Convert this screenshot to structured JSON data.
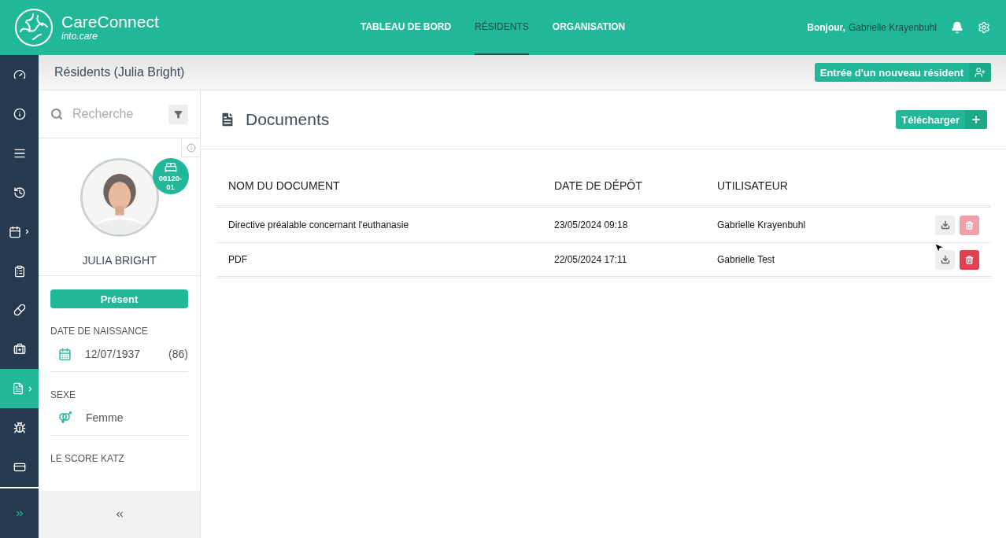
{
  "header": {
    "brand": "CareConnect",
    "brand_sub": "into.care",
    "nav": [
      {
        "label": "TABLEAU DE BORD",
        "selected": false
      },
      {
        "label": "RÉSIDENTS",
        "selected": true
      },
      {
        "label": "ORGANISATION",
        "selected": false
      }
    ],
    "greeting": "Bonjour,",
    "user": "Gabrielle Krayenbuhl"
  },
  "sidebar": {
    "items": [
      {
        "selected": false,
        "has_submenu": false
      },
      {
        "selected": false,
        "has_submenu": false
      },
      {
        "selected": false,
        "has_submenu": false
      },
      {
        "selected": false,
        "has_submenu": false
      },
      {
        "selected": false,
        "has_submenu": true
      },
      {
        "selected": false,
        "has_submenu": false
      },
      {
        "selected": false,
        "has_submenu": false
      },
      {
        "selected": false,
        "has_submenu": false
      },
      {
        "selected": true,
        "has_submenu": true
      },
      {
        "selected": false,
        "has_submenu": false
      },
      {
        "selected": false,
        "has_submenu": false
      }
    ]
  },
  "breadcrumb": "Résidents (Julia Bright)",
  "new_resident_button": "Entrée d'un nouveau résident",
  "resident_panel": {
    "search": {
      "placeholder": "Recherche"
    },
    "room_badge": "00120-01",
    "name": "JULIA BRIGHT",
    "status": "Présent",
    "fields": [
      {
        "kind": "date",
        "label": "DATE DE NAISSANCE",
        "value": "12/07/1937",
        "extra": "(86)"
      },
      {
        "kind": "gender",
        "label": "SEXE",
        "value": "Femme"
      }
    ],
    "next_section": "LE SCORE KATZ"
  },
  "documents": {
    "title": "Documents",
    "upload_button": "Télécharger",
    "columns": [
      "NOM DU DOCUMENT",
      "DATE DE DÉPÔT",
      "UTILISATEUR"
    ],
    "rows": [
      {
        "name": "Directive préalable concernant l'euthanasie",
        "date": "23/05/2024 09:18",
        "user": "Gabrielle Krayenbuhl",
        "delete_disabled": true
      },
      {
        "name": "PDF",
        "date": "22/05/2024 17:11",
        "user": "Gabrielle Test",
        "delete_disabled": false
      }
    ]
  }
}
